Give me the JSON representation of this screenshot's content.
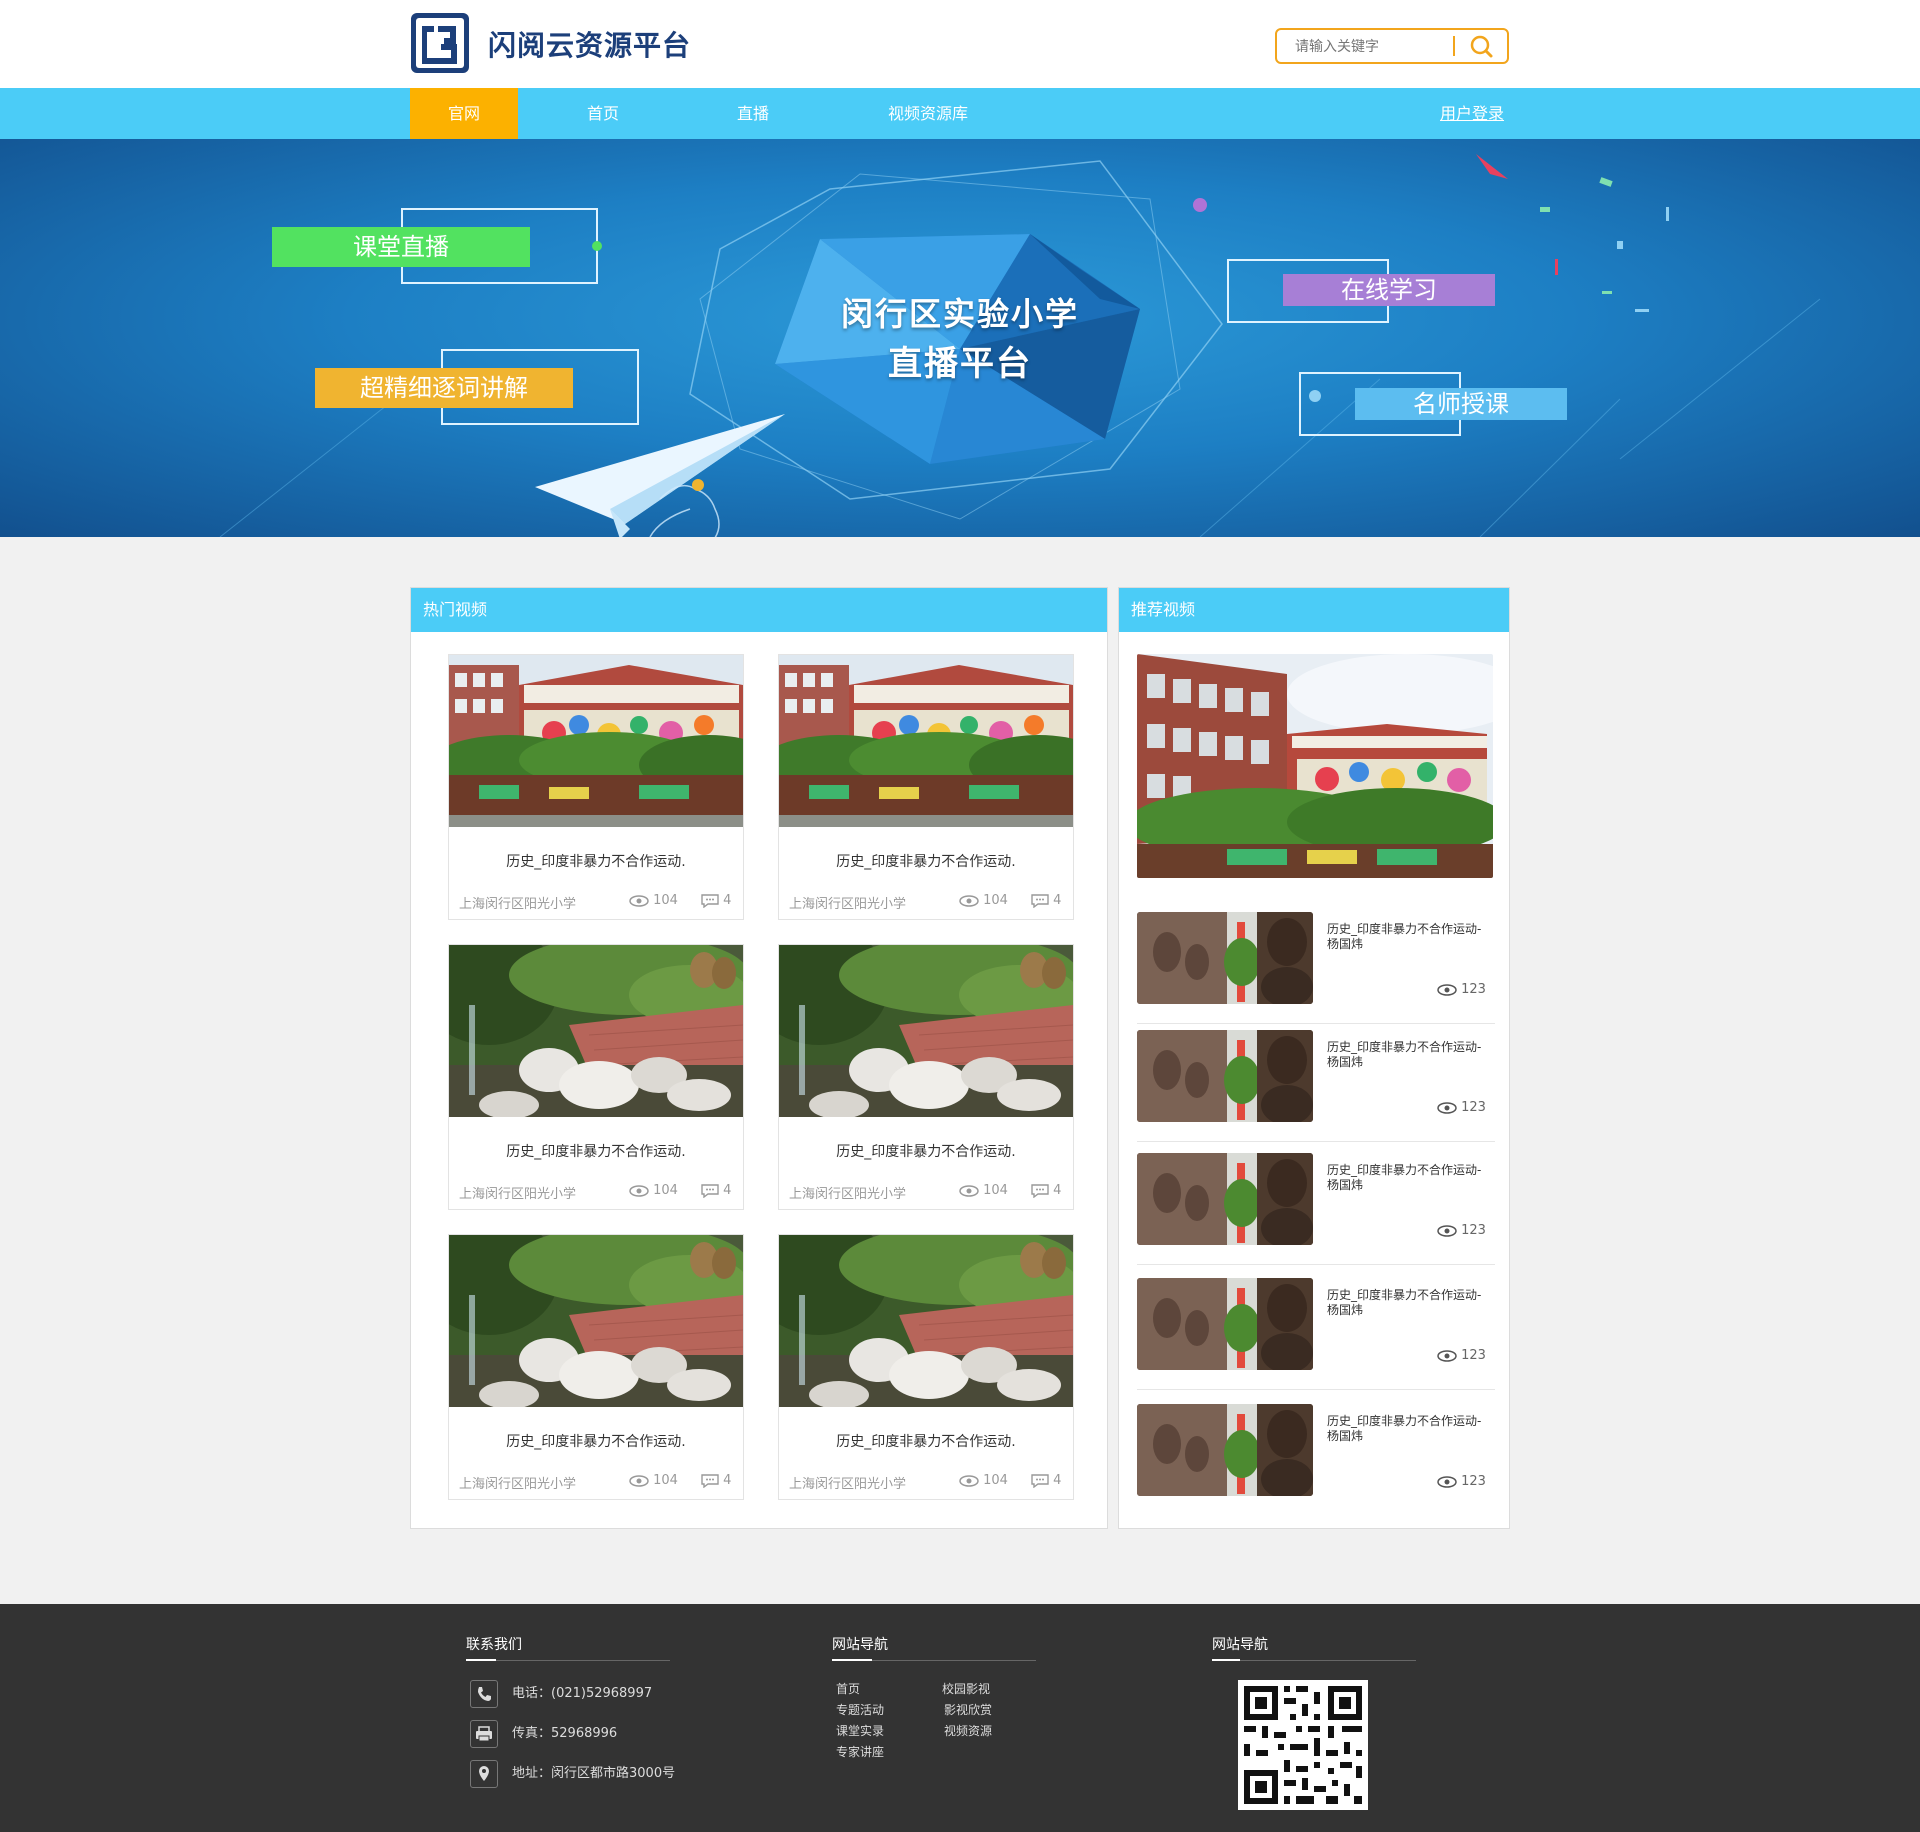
{
  "header": {
    "brand": "闪阅云资源平台",
    "search_placeholder": "请输入关键字"
  },
  "nav": {
    "items": [
      "官网",
      "首页",
      "直播",
      "视频资源库"
    ],
    "active_index": 0,
    "login": "用户登录"
  },
  "banner": {
    "title_line1": "闵行区实验小学",
    "title_line2": "直播平台",
    "tags": [
      "课堂直播",
      "超精细逐词讲解",
      "在线学习",
      "名师授课"
    ]
  },
  "hot": {
    "title": "热门视频",
    "cards": [
      {
        "title": "历史_印度非暴力不合作运动.",
        "school": "上海闵行区阳光小学",
        "views": "104",
        "comments": "4",
        "thumb": "building"
      },
      {
        "title": "历史_印度非暴力不合作运动.",
        "school": "上海闵行区阳光小学",
        "views": "104",
        "comments": "4",
        "thumb": "building"
      },
      {
        "title": "历史_印度非暴力不合作运动.",
        "school": "上海闵行区阳光小学",
        "views": "104",
        "comments": "4",
        "thumb": "garden"
      },
      {
        "title": "历史_印度非暴力不合作运动.",
        "school": "上海闵行区阳光小学",
        "views": "104",
        "comments": "4",
        "thumb": "garden"
      },
      {
        "title": "历史_印度非暴力不合作运动.",
        "school": "上海闵行区阳光小学",
        "views": "104",
        "comments": "4",
        "thumb": "garden"
      },
      {
        "title": "历史_印度非暴力不合作运动.",
        "school": "上海闵行区阳光小学",
        "views": "104",
        "comments": "4",
        "thumb": "garden"
      }
    ]
  },
  "recommend": {
    "title": "推荐视频",
    "items": [
      {
        "title": "历史_印度非暴力不合作运动-杨国炜",
        "views": "123"
      },
      {
        "title": "历史_印度非暴力不合作运动-杨国炜",
        "views": "123"
      },
      {
        "title": "历史_印度非暴力不合作运动-杨国炜",
        "views": "123"
      },
      {
        "title": "历史_印度非暴力不合作运动-杨国炜",
        "views": "123"
      },
      {
        "title": "历史_印度非暴力不合作运动-杨国炜",
        "views": "123"
      }
    ]
  },
  "footer": {
    "contact_title": "联系我们",
    "phone": "电话：(021)52968997",
    "fax": "传真：52968996",
    "address": "地址：闵行区都市路3000号",
    "nav_title": "网站导航",
    "links": [
      "首页",
      "校园影视",
      "专题活动",
      "影视欣赏",
      "课堂实录",
      "视频资源",
      "专家讲座"
    ],
    "qr_title": "网站导航"
  },
  "colors": {
    "nav": "#4bccf7",
    "active": "#fcb100",
    "accent_search": "#f2a51c",
    "footer": "#333333",
    "tag_green": "#52e260",
    "tag_orange": "#f0b430",
    "tag_purple": "#a77fd6",
    "tag_blue": "#5cbdf0"
  }
}
